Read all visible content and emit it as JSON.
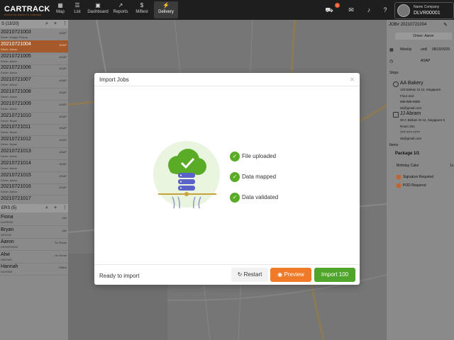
{
  "topbar": {
    "logo": "CARTRACK",
    "logo_sub": "POSITIVE PROFITS LIMITED",
    "nav": [
      {
        "label": "Map",
        "icon": "map-icon"
      },
      {
        "label": "List",
        "icon": "list-icon"
      },
      {
        "label": "Dashboard",
        "icon": "dashboard-icon"
      },
      {
        "label": "Reports",
        "icon": "reports-icon"
      },
      {
        "label": "Miflest",
        "icon": "dollar-icon"
      },
      {
        "label": "Delivery",
        "icon": "bolt-icon"
      }
    ],
    "badge_count": "2",
    "user": {
      "company": "Name Company",
      "id": "DLVR00001"
    }
  },
  "left_panel": {
    "jobs_header": "S (13/20)",
    "jobs": [
      {
        "id": "20210721003",
        "driver": "Driver: Assign Pickup",
        "status": "ASAP"
      },
      {
        "id": "20210721004",
        "driver": "Driver: Aaron",
        "status": "ASAP"
      },
      {
        "id": "20210721005",
        "driver": "Driver: Aaron",
        "status": "ASAP"
      },
      {
        "id": "20210721006",
        "driver": "Driver: Aaron",
        "status": "ASAP"
      },
      {
        "id": "20210721007",
        "driver": "Driver: Aaron",
        "status": "ASAP"
      },
      {
        "id": "20210721008",
        "driver": "Driver: Aaron",
        "status": "ASAP"
      },
      {
        "id": "20210721009",
        "driver": "Driver: Aaron",
        "status": "ASAP"
      },
      {
        "id": "20210721010",
        "driver": "Driver: Bryan",
        "status": "ASAP"
      },
      {
        "id": "20210721011",
        "driver": "Driver: Bryan",
        "status": "ASAP"
      },
      {
        "id": "20210721012",
        "driver": "Driver: Bryan",
        "status": "ASAP"
      },
      {
        "id": "20210721013",
        "driver": "Driver: Aaron",
        "status": "ASAP"
      },
      {
        "id": "20210721014",
        "driver": "Driver: Aaron",
        "status": "ASAP"
      },
      {
        "id": "20210721015",
        "driver": "Driver: Aaron",
        "status": "ASAP"
      },
      {
        "id": "20210721016",
        "driver": "Driver: Aaron",
        "status": "ASAP"
      },
      {
        "id": "20210721017",
        "driver": "",
        "status": ""
      }
    ],
    "drivers_header": "ERS (5)",
    "drivers": [
      {
        "name": "Fiona",
        "code": "DLVR005",
        "status": "Idle"
      },
      {
        "name": "Bryan",
        "code": "DRV002",
        "status": "Idle"
      },
      {
        "name": "Aaron",
        "code": "DRIVER0004",
        "status": "On Route"
      },
      {
        "name": "Alwi",
        "code": "ARI2180",
        "status": "On Route"
      },
      {
        "name": "Hannah",
        "code": "DLV0003",
        "status": "Offline"
      }
    ]
  },
  "right_panel": {
    "job_title": "JOB# 20210721004",
    "driver": "Driver: Aaron",
    "repeat": "Weekly",
    "until_label": "until",
    "until_date": "08/10/2029",
    "time": "ASAP",
    "stops_label": "Stops",
    "stops": [
      {
        "name": "AA Bakery",
        "lines": [
          "120 Bishan St 12, Singapore",
          "Floor 2nd",
          "888-888-8888",
          "ab@gmail.com"
        ]
      },
      {
        "name": "JJ Abram",
        "lines": [
          "30 C Bishan St 12, Singapore 5",
          "Room 201",
          "777-777-7777",
          "ab@gmail.com"
        ]
      }
    ],
    "items_label": "Items",
    "package": "Package 1/1",
    "item": "Birthday Cake",
    "item_qty": "1x",
    "checks": [
      "Signature Required",
      "POD Required"
    ]
  },
  "modal": {
    "title": "Import Jobs",
    "steps": [
      "File uploaded",
      "Data mapped",
      "Data validated"
    ],
    "status": "Ready to import",
    "restart": "Restart",
    "preview": "Preview",
    "import": "Import 100"
  },
  "colors": {
    "accent_orange": "#f07a27",
    "success_green": "#5aab25",
    "import_green": "#4ea52a"
  }
}
